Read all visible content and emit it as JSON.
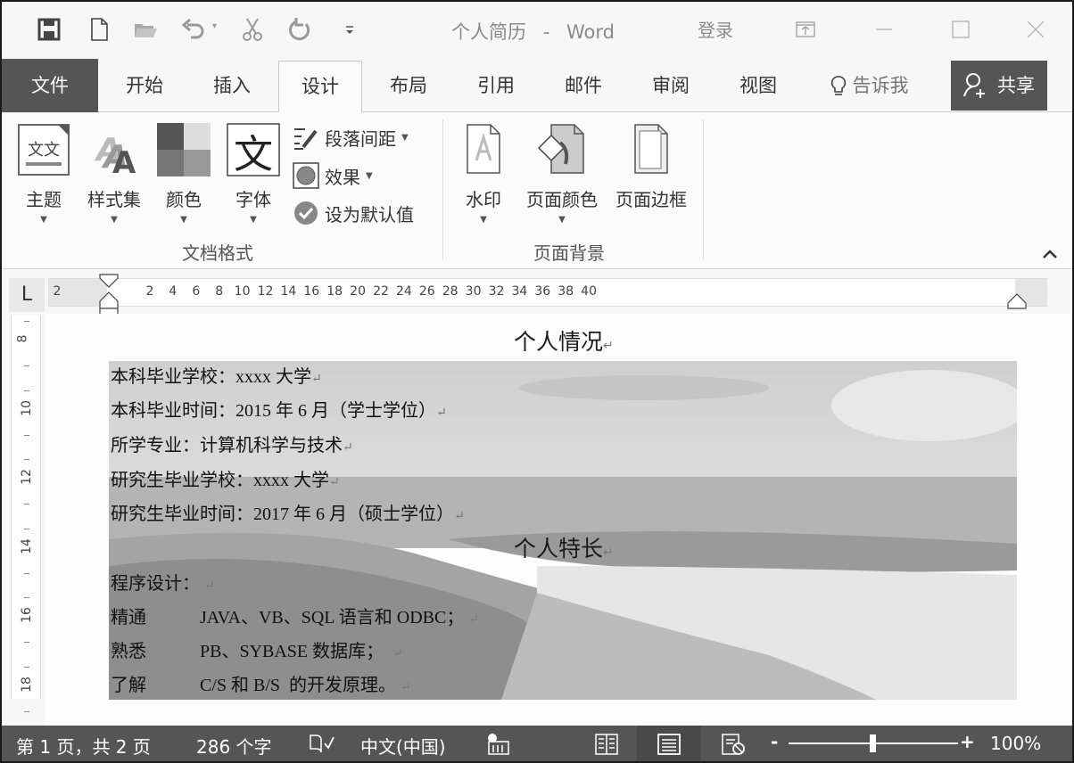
{
  "app": {
    "document_title": "个人简历",
    "title_separator": "-",
    "app_name": "Word",
    "login_label": "登录"
  },
  "quick_access": [
    {
      "name": "save",
      "icon": "save-icon"
    },
    {
      "name": "new",
      "icon": "new-document-icon"
    },
    {
      "name": "open",
      "icon": "open-folder-icon"
    },
    {
      "name": "undo",
      "icon": "undo-icon"
    },
    {
      "name": "cut",
      "icon": "cut-icon"
    },
    {
      "name": "redo",
      "icon": "redo-icon"
    },
    {
      "name": "customize",
      "icon": "customize-qat-icon"
    }
  ],
  "window_controls": [
    "ribbon-display-options-icon",
    "minimize-icon",
    "maximize-icon",
    "close-icon"
  ],
  "tabs": {
    "file": "文件",
    "items": [
      "开始",
      "插入",
      "设计",
      "布局",
      "引用",
      "邮件",
      "审阅",
      "视图"
    ],
    "active": "设计",
    "tell_me": "告诉我",
    "share": "共享"
  },
  "ribbon": {
    "document_format": {
      "label": "文档格式",
      "themes": "主题",
      "style_set": "样式集",
      "colors": "颜色",
      "fonts": "字体",
      "paragraph_spacing": "段落间距",
      "effects": "效果",
      "set_as_default": "设为默认值",
      "theme_glyph": "文文",
      "font_glyph": "文"
    },
    "page_background": {
      "label": "页面背景",
      "watermark": "水印",
      "page_color": "页面颜色",
      "page_borders": "页面边框"
    },
    "collapse_icon": "chevron-up-icon"
  },
  "ruler": {
    "tab_selector": "L",
    "left_margin_tick": "2",
    "ticks": [
      "2",
      "4",
      "6",
      "8",
      "10",
      "12",
      "14",
      "16",
      "18",
      "20",
      "22",
      "24",
      "26",
      "28",
      "30",
      "32",
      "34",
      "36",
      "38",
      "40"
    ],
    "vertical_ticks": [
      "8",
      "10",
      "12",
      "14",
      "16",
      "18"
    ]
  },
  "document": {
    "heading1": "个人情况",
    "education": [
      "本科毕业学校：xxxx 大学",
      "本科毕业时间：2015 年 6 月（学士学位）",
      "所学专业：计算机科学与技术",
      "研究生毕业学校：xxxx 大学",
      "研究生毕业时间：2017 年 6 月（硕士学位）"
    ],
    "heading2": "个人特长",
    "programming_label": "程序设计：",
    "skills": [
      {
        "level": "精通",
        "detail": "JAVA、VB、SQL 语言和 ODBC；"
      },
      {
        "level": "熟悉",
        "detail": "PB、SYBASE 数据库；"
      },
      {
        "level": "了解",
        "detail": "C/S 和 B/S  的开发原理。"
      }
    ],
    "paragraph_mark": "↵"
  },
  "statusbar": {
    "page_info": "第 1 页，共 2 页",
    "word_count": "286 个字",
    "language": "中文(中国)",
    "zoom_minus": "-",
    "zoom_plus": "+",
    "zoom_level": "100%",
    "zoom_fraction": 0.5
  },
  "colors": {
    "chrome_dark": "#555555",
    "ribbon_bg": "#fbfbfb",
    "window_bg": "#f7f7f7"
  }
}
